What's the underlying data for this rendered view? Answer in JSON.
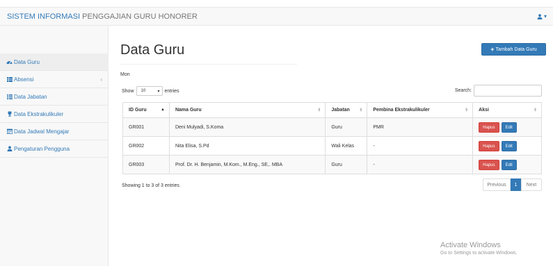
{
  "navbar": {
    "brand_highlight": "SISTEM INFORMASI",
    "brand_rest": " PENGGAJIAN GURU HONORER",
    "user_caret": "▾"
  },
  "sidebar": {
    "items": [
      {
        "label": "Data Guru",
        "icon": "dashboard-icon",
        "active": true
      },
      {
        "label": "Absensi",
        "icon": "table-icon",
        "caret": "‹"
      },
      {
        "label": "Data Jabatan",
        "icon": "list-icon"
      },
      {
        "label": "Data Ekstrakulikuler",
        "icon": "trophy-icon"
      },
      {
        "label": "Data Jadwal Mengajar",
        "icon": "calendar-icon"
      },
      {
        "label": "Pengaturan Pengguna",
        "icon": "user-icon"
      }
    ]
  },
  "main": {
    "title": "Data Guru",
    "add_button": "Tambah Data Guru",
    "day_label": "Mon",
    "show_label": "Show",
    "entries_value": "10",
    "entries_label": "entries",
    "search_label": "Search:",
    "search_value": "",
    "columns": [
      "ID Guru",
      "Nama Guru",
      "Jabatan",
      "Pembina Ekstrakulikuler",
      "Aksi"
    ],
    "rows": [
      {
        "id": "GR001",
        "nama": "Deni Mulyadi, S.Koma",
        "jabatan": "Guru",
        "pembina": "PMR"
      },
      {
        "id": "GR002",
        "nama": "Nita Elisa, S.Pd",
        "jabatan": "Wali Kelas",
        "pembina": "-"
      },
      {
        "id": "GR003",
        "nama": "Prof. Dr. H. Benjamin, M.Kom., M.Eng., SE,. MBA",
        "jabatan": "Guru",
        "pembina": "-"
      }
    ],
    "delete_label": "Hapus",
    "edit_label": "Edit",
    "info": "Showing 1 to 3 of 3 entries",
    "pager": {
      "prev": "Previous",
      "current": "1",
      "next": "Next"
    }
  },
  "watermark": {
    "line1": "Activate Windows",
    "line2": "Go to Settings to activate Windows."
  },
  "colors": {
    "primary": "#337ab7",
    "danger": "#d9534f",
    "sidebar_bg": "#f8f8f8"
  }
}
